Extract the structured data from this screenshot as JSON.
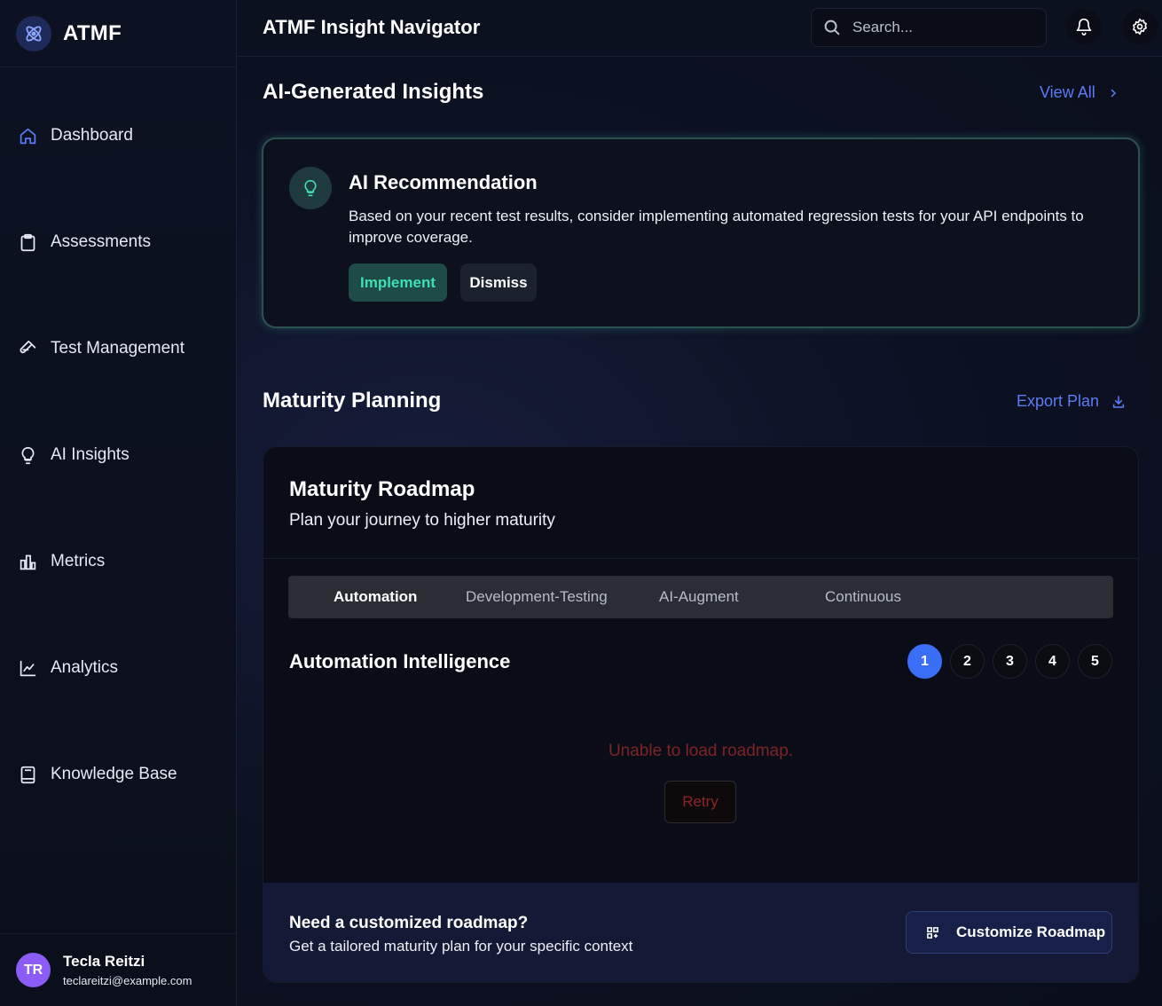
{
  "brand": {
    "name": "ATMF"
  },
  "header": {
    "title": "ATMF Insight Navigator",
    "search_placeholder": "Search..."
  },
  "sidebar": {
    "items": [
      {
        "label": "Dashboard",
        "icon": "home-icon"
      },
      {
        "label": "Assessments",
        "icon": "clipboard-icon"
      },
      {
        "label": "Test Management",
        "icon": "test-tube-icon"
      },
      {
        "label": "AI Insights",
        "icon": "lightbulb-icon"
      },
      {
        "label": "Metrics",
        "icon": "bar-chart-icon"
      },
      {
        "label": "Analytics",
        "icon": "line-chart-icon"
      },
      {
        "label": "Knowledge Base",
        "icon": "book-icon"
      }
    ]
  },
  "user": {
    "initials": "TR",
    "name": "Tecla Reitzi",
    "email": "teclareitzi@example.com"
  },
  "insights": {
    "title": "AI-Generated Insights",
    "view_all": "View All",
    "card": {
      "title": "AI Recommendation",
      "text": "Based on your recent test results, consider implementing automated regression tests for your API endpoints to improve coverage.",
      "implement_label": "Implement",
      "dismiss_label": "Dismiss"
    }
  },
  "maturity": {
    "title": "Maturity Planning",
    "export_label": "Export Plan",
    "roadmap": {
      "title": "Maturity Roadmap",
      "subtitle": "Plan your journey to higher maturity",
      "tabs": [
        "Automation",
        "Development-Testing",
        "AI-Augment",
        "Continuous"
      ],
      "active_tab": "Automation",
      "section_title": "Automation Intelligence",
      "steps": [
        "1",
        "2",
        "3",
        "4",
        "5"
      ],
      "active_step": "1",
      "error_text": "Unable to load roadmap.",
      "retry_label": "Retry",
      "footer": {
        "title": "Need a customized roadmap?",
        "subtitle": "Get a tailored maturity plan for your specific context",
        "button_label": "Customize Roadmap"
      }
    }
  },
  "colors": {
    "accent": "#3b6ef6",
    "link": "#5b7cf5",
    "success": "#3fe0b0",
    "error": "#7d2424",
    "avatar": "#8b5cf6"
  }
}
